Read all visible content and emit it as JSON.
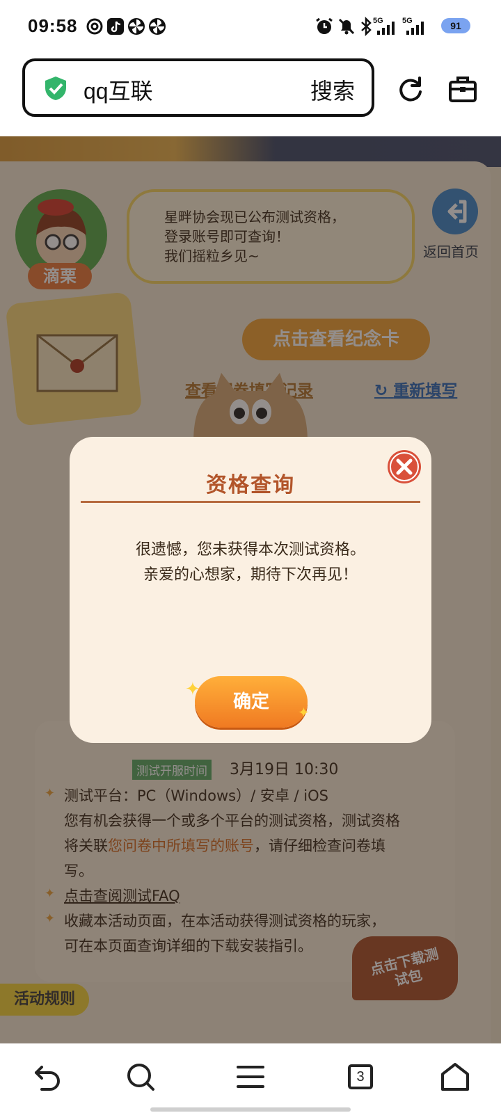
{
  "status_bar": {
    "time": "09:58",
    "left_icons": [
      "swirl-icon",
      "tiktok-icon",
      "pinwheel-icon",
      "pinwheel-icon"
    ],
    "right_icons": [
      "alarm-icon",
      "bell-off-icon",
      "bluetooth-icon",
      "signal-5g-icon",
      "signal-5g-icon"
    ],
    "network_1": "5G",
    "network_2": "5G",
    "battery": "91"
  },
  "browser": {
    "url_text": "qq互联",
    "search_label": "搜索",
    "reload_icon": "reload-icon",
    "toolbox_icon": "toolbox-icon"
  },
  "page": {
    "character_name": "滴栗",
    "bubble_lines": [
      "星畔协会现已公布测试资格，",
      "登录账号即可查询！",
      "我们摇粒乡见~"
    ],
    "home_button_label": "返回首页",
    "view_card_button": "点击查看纪念卡",
    "view_record_link": "查看问卷填写记录",
    "refill_link": "重新填写",
    "test_open_tag": "测试开服时间",
    "test_open_time": "3月19日  10:30",
    "platform_line": "测试平台：PC（Windows）/ 安卓 / iOS",
    "desc_line_1": "您有机会获得一个或多个平台的测试资格，测试资格",
    "desc_line_2a": "将关联",
    "desc_line_2b": "您问卷中所填写的账号",
    "desc_line_2c": "，请仔细检查问卷填",
    "desc_line_3": "写。",
    "faq_link": "点击查阅测试FAQ",
    "collect_line_1": "收藏本活动页面，在本活动获得测试资格的玩家，",
    "collect_line_2": "可在本页面查询详细的下载安装指引。",
    "download_badge": "点击下载测试包",
    "rules_tab": "活动规则"
  },
  "modal": {
    "title": "资格查询",
    "message_line_1": "很遗憾，您未获得本次测试资格。",
    "message_line_2": "亲爱的心想家，期待下次再见！",
    "confirm_label": "确定",
    "close_icon": "close-icon"
  },
  "nav_bar": {
    "tab_count": "3",
    "items": [
      "back-icon",
      "search-icon",
      "menu-icon",
      "tabs-icon",
      "home-icon"
    ]
  },
  "colors": {
    "accent_orange": "#f07a22",
    "modal_title": "#b2552a",
    "close_red": "#d9503a",
    "link_orange": "#d2691e",
    "tag_green": "#5aa864"
  }
}
